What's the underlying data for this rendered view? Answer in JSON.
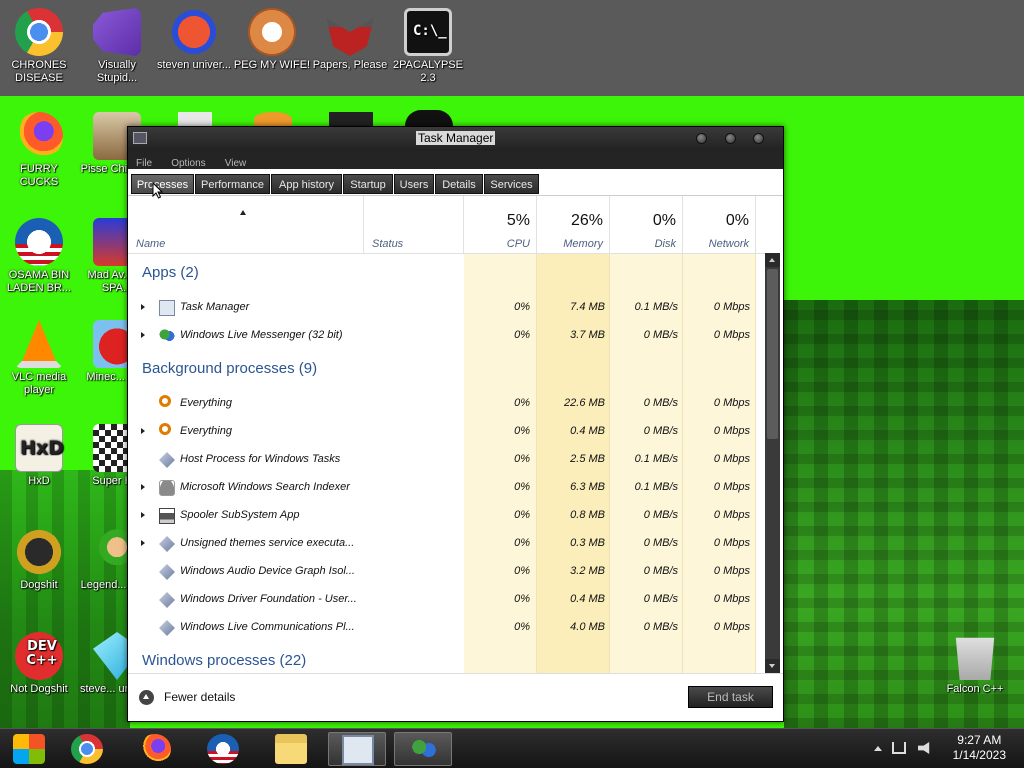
{
  "desktop": {
    "icons": [
      {
        "label": "CHRONES DISEASE",
        "icon": "chrome-icon"
      },
      {
        "label": "Visually Stupid...",
        "icon": "visual-studio-icon"
      },
      {
        "label": "steven univer...",
        "icon": "steven-universe-icon"
      },
      {
        "label": "PEG MY WIFE!",
        "icon": "p-logo-icon"
      },
      {
        "label": "Papers, Please",
        "icon": "papers-please-icon"
      },
      {
        "label": "2PACALYPSE 2.3",
        "icon": "command-prompt-icon"
      },
      {
        "label": "FURRY CUCKS",
        "icon": "firefox-icon"
      },
      {
        "label": "Pisse Chicke...",
        "icon": "game-icon"
      },
      {
        "label": "OSAMA BIN LADEN BR...",
        "icon": "obama-logo-icon"
      },
      {
        "label": "Mad Av... IN SPA...",
        "icon": "game-icon"
      },
      {
        "label": "VLC media player",
        "icon": "vlc-icon"
      },
      {
        "label": "Minec... Bird",
        "icon": "angry-bird-icon"
      },
      {
        "label": "HxD",
        "icon": "hxd-icon"
      },
      {
        "label": "Super H...",
        "icon": "checker-icon"
      },
      {
        "label": "Dogshit",
        "icon": "cpp-icon"
      },
      {
        "label": "Legend... Zilda",
        "icon": "game-icon"
      },
      {
        "label": "Not Dogshit",
        "icon": "dev-cpp-icon"
      },
      {
        "label": "steve... unive...",
        "icon": "diamond-icon"
      },
      {
        "label": "Falcon C++",
        "icon": "recycle-bin-icon"
      }
    ],
    "hxd_text": "HxD",
    "cmd_text": "C:\\_",
    "devcpp_text": "DEV C++"
  },
  "window": {
    "title": "Task Manager",
    "menu": [
      "File",
      "Options",
      "View"
    ],
    "tabs": [
      "Processes",
      "Performance",
      "App history",
      "Startup",
      "Users",
      "Details",
      "Services"
    ],
    "active_tab": "Processes"
  },
  "columns": {
    "name": "Name",
    "status": "Status",
    "cpu": {
      "label": "CPU",
      "percent": "5%"
    },
    "memory": {
      "label": "Memory",
      "percent": "26%"
    },
    "disk": {
      "label": "Disk",
      "percent": "0%"
    },
    "network": {
      "label": "Network",
      "percent": "0%"
    }
  },
  "groups": [
    {
      "label": "Apps (2)"
    },
    {
      "label": "Background processes (9)"
    },
    {
      "label": "Windows processes (22)"
    }
  ],
  "processes": [
    {
      "name": "Task Manager",
      "cpu": "0%",
      "memory": "7.4 MB",
      "disk": "0.1 MB/s",
      "network": "0 Mbps",
      "expandable": true,
      "icon": "task-manager-icon"
    },
    {
      "name": "Windows Live Messenger (32 bit)",
      "cpu": "0%",
      "memory": "3.7 MB",
      "disk": "0 MB/s",
      "network": "0 Mbps",
      "expandable": true,
      "icon": "messenger-icon"
    },
    {
      "name": "Everything",
      "cpu": "0%",
      "memory": "22.6 MB",
      "disk": "0 MB/s",
      "network": "0 Mbps",
      "expandable": false,
      "icon": "search-icon"
    },
    {
      "name": "Everything",
      "cpu": "0%",
      "memory": "0.4 MB",
      "disk": "0 MB/s",
      "network": "0 Mbps",
      "expandable": true,
      "icon": "search-icon"
    },
    {
      "name": "Host Process for Windows Tasks",
      "cpu": "0%",
      "memory": "2.5 MB",
      "disk": "0.1 MB/s",
      "network": "0 Mbps",
      "expandable": false,
      "icon": "process-icon"
    },
    {
      "name": "Microsoft Windows Search Indexer",
      "cpu": "0%",
      "memory": "6.3 MB",
      "disk": "0.1 MB/s",
      "network": "0 Mbps",
      "expandable": true,
      "icon": "user-icon"
    },
    {
      "name": "Spooler SubSystem App",
      "cpu": "0%",
      "memory": "0.8 MB",
      "disk": "0 MB/s",
      "network": "0 Mbps",
      "expandable": true,
      "icon": "printer-icon"
    },
    {
      "name": "Unsigned themes service executa...",
      "cpu": "0%",
      "memory": "0.3 MB",
      "disk": "0 MB/s",
      "network": "0 Mbps",
      "expandable": true,
      "icon": "process-icon"
    },
    {
      "name": "Windows Audio Device Graph Isol...",
      "cpu": "0%",
      "memory": "3.2 MB",
      "disk": "0 MB/s",
      "network": "0 Mbps",
      "expandable": false,
      "icon": "process-icon"
    },
    {
      "name": "Windows Driver Foundation - User...",
      "cpu": "0%",
      "memory": "0.4 MB",
      "disk": "0 MB/s",
      "network": "0 Mbps",
      "expandable": false,
      "icon": "process-icon"
    },
    {
      "name": "Windows Live Communications Pl...",
      "cpu": "0%",
      "memory": "4.0 MB",
      "disk": "0 MB/s",
      "network": "0 Mbps",
      "expandable": false,
      "icon": "process-icon"
    }
  ],
  "footer": {
    "fewer_details": "Fewer details",
    "end_task": "End task"
  },
  "taskbar": {
    "buttons": [
      "start-icon",
      "chrome-icon",
      "firefox-icon",
      "obama-logo-icon",
      "file-explorer-icon",
      "task-manager-icon",
      "messenger-icon"
    ],
    "time": "9:27 AM",
    "date": "1/14/2023"
  },
  "colors": {
    "desktop_green": "#3df508",
    "group_blue": "#2b5592",
    "heat_light": "#fdf6d9",
    "heat_mid": "#fbeebb",
    "window_dark": "#1e1e1e"
  }
}
